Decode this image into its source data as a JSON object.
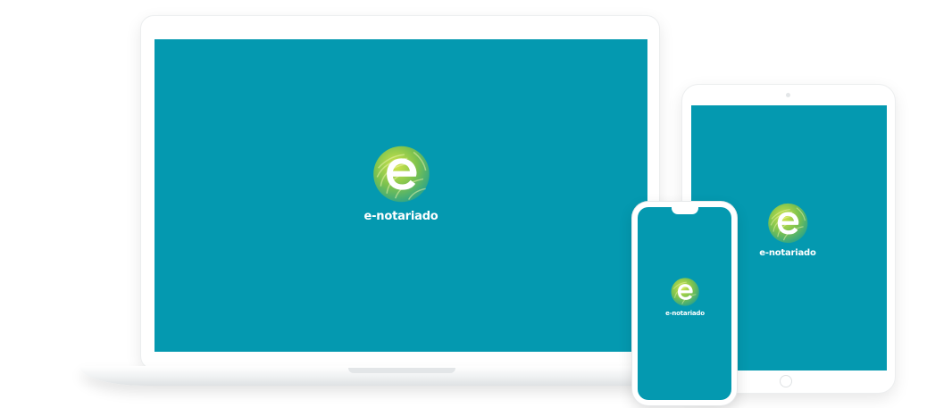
{
  "brand": {
    "name": "e-notariado",
    "screen_color": "#0499b0",
    "logo_colors": [
      "#c8de3a",
      "#5cb85c",
      "#2aa38a"
    ],
    "logo_icon": "fingerprint-e-logo-icon"
  },
  "devices": {
    "laptop": {
      "label": "e-notariado"
    },
    "tablet": {
      "label": "e-notariado"
    },
    "phone": {
      "label": "e-notariado"
    }
  }
}
